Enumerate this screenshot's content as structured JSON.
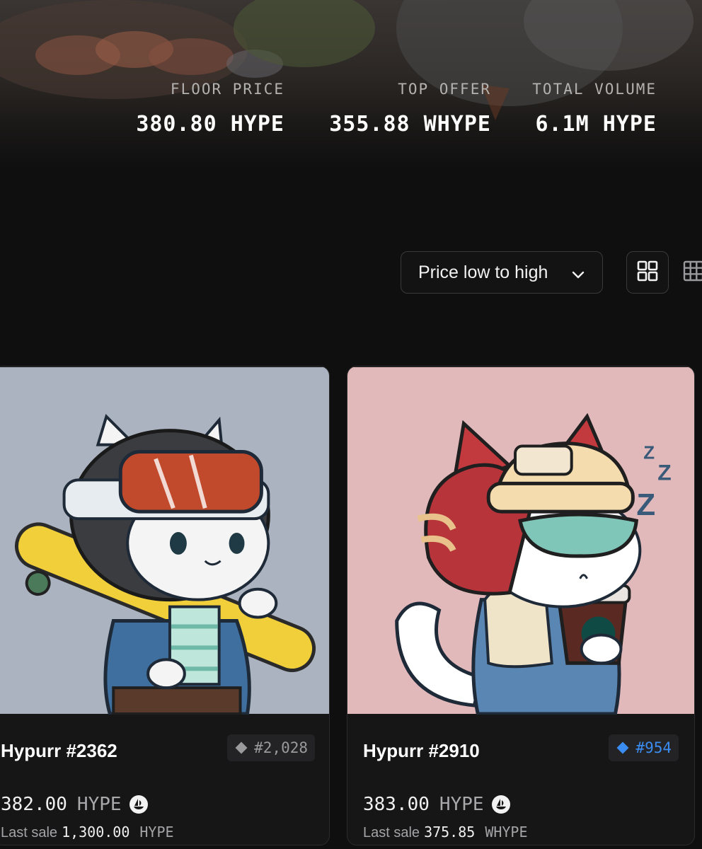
{
  "stats": [
    {
      "label": "FLOOR PRICE",
      "value": "380.80 HYPE"
    },
    {
      "label": "TOP OFFER",
      "value": "355.88 WHYPE"
    },
    {
      "label": "TOTAL VOLUME",
      "value": "6.1M HYPE"
    }
  ],
  "sort": {
    "selected": "Price low to high"
  },
  "icons": {
    "sort_chevron": "chevron-down-icon",
    "view_large": "grid-2x2-icon",
    "view_small": "grid-3x3-icon",
    "marketplace": "opensea-icon"
  },
  "cards": [
    {
      "name": "Hypurr #2362",
      "rank": "#2,028",
      "rank_color": "#9a9a9c",
      "price": "382.00",
      "price_currency": "HYPE",
      "last_sale_label": "Last sale",
      "last_sale_value": "1,300.00",
      "last_sale_currency": "HYPE",
      "art_background": "#aab3bf"
    },
    {
      "name": "Hypurr #2910",
      "rank": "#954",
      "rank_color": "#3b8cf0",
      "price": "383.00",
      "price_currency": "HYPE",
      "last_sale_label": "Last sale",
      "last_sale_value": "375.85",
      "last_sale_currency": "WHYPE",
      "art_background": "#e2b9bb"
    }
  ]
}
